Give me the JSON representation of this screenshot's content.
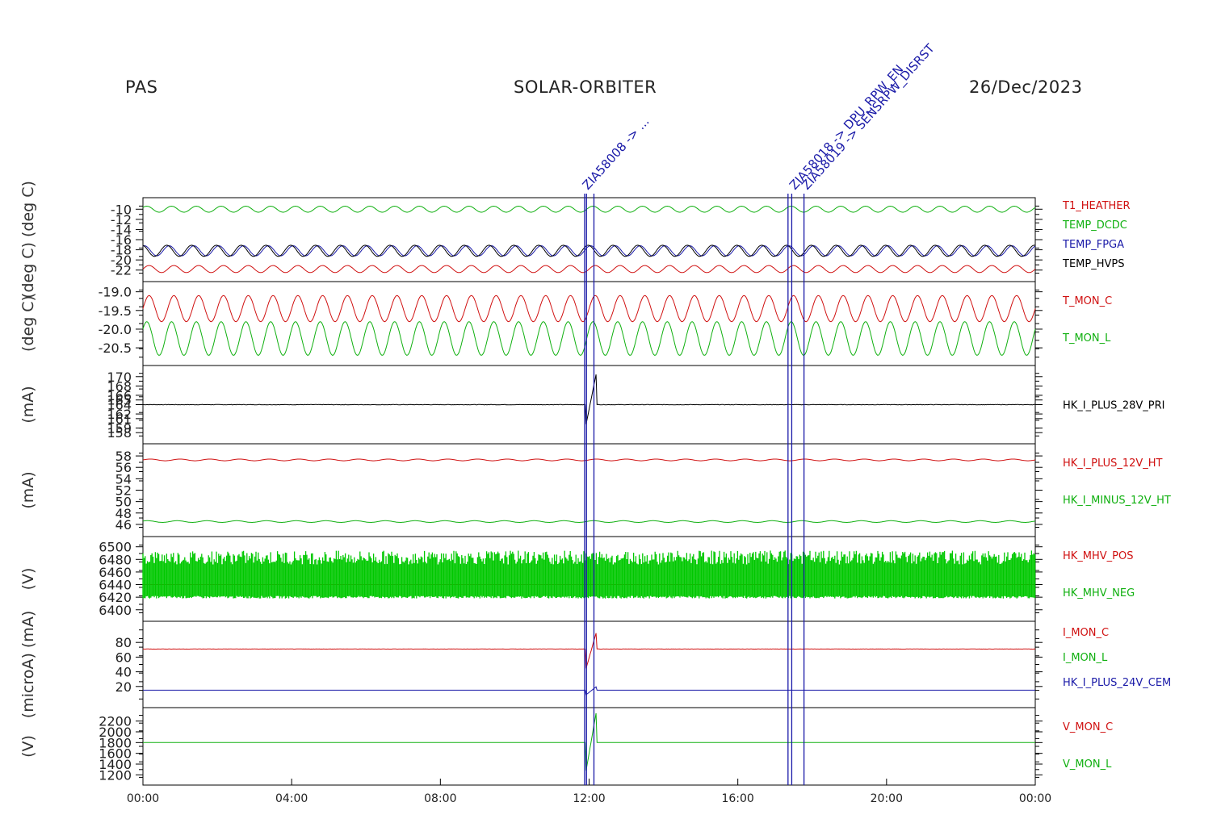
{
  "header": {
    "left": "PAS",
    "center": "SOLAR-ORBITER",
    "right": "26/Dec/2023"
  },
  "colors": {
    "red": "#d01010",
    "green": "#10b010",
    "blue": "#1a1aa8",
    "black": "#000000",
    "fill_green": "#00c800"
  },
  "chart_data": {
    "type": "line",
    "x_axis": {
      "ticks": [
        "00:00",
        "04:00",
        "08:00",
        "12:00",
        "16:00",
        "20:00",
        "00:00"
      ],
      "range_hours": [
        0,
        24
      ]
    },
    "event_lines_hours": [
      11.88,
      11.93,
      12.13,
      17.35,
      17.45,
      17.78
    ],
    "annotations": [
      {
        "text": "ZIA58008 -> ...",
        "hour": 11.88
      },
      {
        "text": "ZIA58018 -> DPU_RPW_EN",
        "hour": 17.45
      },
      {
        "text": "ZIA58019 -> SENSRPW_DISRST",
        "hour": 17.78
      }
    ],
    "panels": [
      {
        "ylabel": "(deg C)   (deg C)",
        "yticks": [
          "-10",
          "-12",
          "-14",
          "-16",
          "-18",
          "-20",
          "-22"
        ],
        "ylim": [
          -23,
          -9
        ],
        "series": [
          {
            "name": "T1_HEATHER",
            "color": "red",
            "base": -21.8,
            "amp": 0.7,
            "periods": 36
          },
          {
            "name": "TEMP_DCDC",
            "color": "green",
            "base": -10,
            "amp": 0.6,
            "periods": 36
          },
          {
            "name": "TEMP_FPGA",
            "color": "blue",
            "base": -18.2,
            "amp": 1.0,
            "periods": 36
          },
          {
            "name": "TEMP_HVPS",
            "color": "black",
            "base": -18.2,
            "amp": 1.1,
            "periods": 36
          }
        ]
      },
      {
        "ylabel": "(deg C)",
        "yticks": [
          "-19.0",
          "-19.5",
          "-20.0",
          "-20.5"
        ],
        "ylim": [
          -20.8,
          -18.9
        ],
        "series": [
          {
            "name": "T_MON_C",
            "color": "red",
            "base": -19.45,
            "amp": 0.35,
            "periods": 36
          },
          {
            "name": "T_MON_L",
            "color": "green",
            "base": -20.25,
            "amp": 0.45,
            "periods": 36
          }
        ]
      },
      {
        "ylabel": "(mA)",
        "yticks": [
          "170",
          "168",
          "166",
          "165",
          "164",
          "162",
          "161",
          "159",
          "158"
        ],
        "ylim": [
          157,
          171
        ],
        "series": [
          {
            "name": "HK_I_PLUS_28V_PRI",
            "color": "black",
            "base": 164,
            "amp": 0.1,
            "periods": 0
          }
        ]
      },
      {
        "ylabel": "(mA)",
        "yticks": [
          "58",
          "56",
          "54",
          "52",
          "50",
          "48",
          "46"
        ],
        "ylim": [
          45,
          59
        ],
        "series": [
          {
            "name": "HK_I_PLUS_12V_HT",
            "color": "red",
            "base": 57.3,
            "amp": 0.15,
            "periods": 30
          },
          {
            "name": "HK_I_MINUS_12V_HT",
            "color": "green",
            "base": 46.5,
            "amp": 0.15,
            "periods": 30
          }
        ]
      },
      {
        "ylabel": "(V)",
        "yticks": [
          "6500",
          "6480",
          "6460",
          "6440",
          "6420",
          "6400"
        ],
        "ylim": [
          6392,
          6506
        ],
        "series": [
          {
            "name": "HK_MHV_POS",
            "color": "red",
            "base": 6440,
            "amp": 0,
            "periods": 0
          },
          {
            "name": "HK_MHV_NEG",
            "color": "green",
            "base": 6460,
            "amp": 35,
            "periods": 0
          }
        ]
      },
      {
        "ylabel": "(microA)   (mA)",
        "yticks": [
          "80",
          "60",
          "40",
          "20"
        ],
        "ylim": [
          0,
          100
        ],
        "series": [
          {
            "name": "I_MON_C",
            "color": "red",
            "base": 71,
            "amp": 0.3,
            "periods": 0
          },
          {
            "name": "I_MON_L",
            "color": "green",
            "base": 0,
            "amp": 0,
            "periods": 0
          },
          {
            "name": "HK_I_PLUS_24V_CEM",
            "color": "blue",
            "base": 15,
            "amp": 0,
            "periods": 0
          }
        ]
      },
      {
        "ylabel": "(V)",
        "yticks": [
          "2200",
          "2000",
          "1800",
          "1600",
          "1400",
          "1200"
        ],
        "ylim": [
          1130,
          2330
        ],
        "series": [
          {
            "name": "V_MON_C",
            "color": "red",
            "base": 1800,
            "amp": 0,
            "periods": 0
          },
          {
            "name": "V_MON_L",
            "color": "green",
            "base": 1800,
            "amp": 0,
            "periods": 0
          }
        ]
      }
    ]
  }
}
